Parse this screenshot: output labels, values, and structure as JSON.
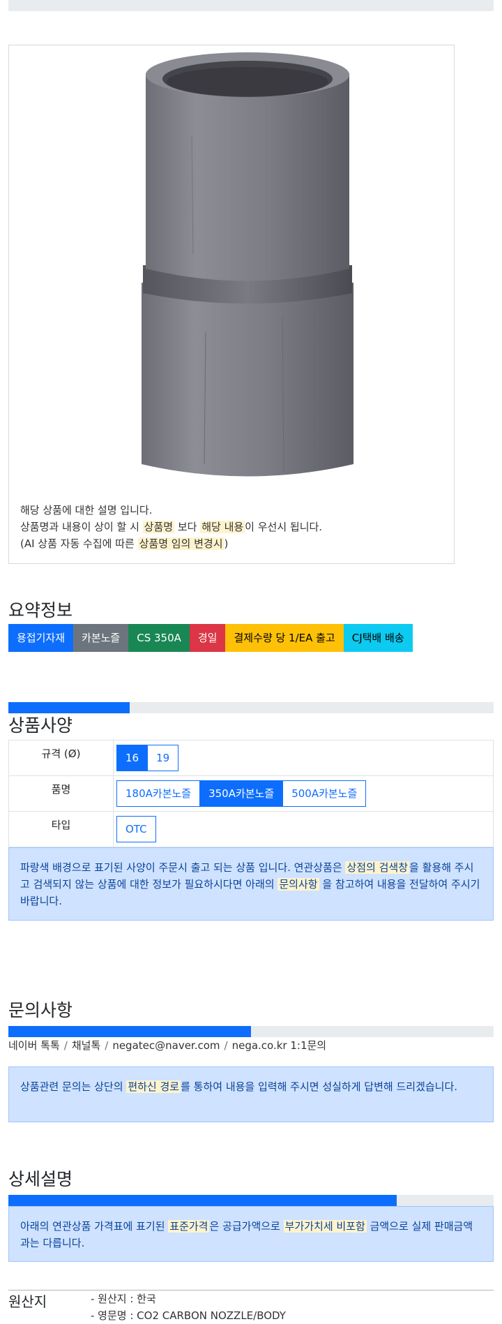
{
  "product": {
    "image_name": "carbon-nozzle-image",
    "desc_line1": "해당 상품에 대한 설명 입니다.",
    "desc_line2_a": "상품명과 내용이 상이 할 시 ",
    "desc_line2_hl1": "상품명",
    "desc_line2_b": " 보다 ",
    "desc_line2_hl2": "해당 내용",
    "desc_line2_c": "이 우선시 됩니다.",
    "desc_line3_a": "(AI 상품 자동 수집에 따른 ",
    "desc_line3_hl": "상품명 임의 변경시",
    "desc_line3_b": ")"
  },
  "summary": {
    "title": "요약정보",
    "badges": [
      {
        "label": "용접기자재",
        "color": "#0d6efd",
        "text_color": "#ffffff"
      },
      {
        "label": "카본노즐",
        "color": "#6c757d",
        "text_color": "#ffffff"
      },
      {
        "label": "CS 350A",
        "color": "#198754",
        "text_color": "#ffffff"
      },
      {
        "label": "경일",
        "color": "#dc3545",
        "text_color": "#ffffff"
      },
      {
        "label": "결제수량 당 1/EA 출고",
        "color": "#ffc107",
        "text_color": "#000000"
      },
      {
        "label": "CJ택배 배송",
        "color": "#0dcaf0",
        "text_color": "#000000"
      }
    ]
  },
  "spec": {
    "title": "상품사양",
    "progress_fraction": 0.25,
    "rows": [
      {
        "label": "규격 (Ø)",
        "options": [
          {
            "label": "16",
            "active": true
          },
          {
            "label": "19",
            "active": false
          }
        ]
      },
      {
        "label": "품명",
        "options": [
          {
            "label": "180A카본노즐",
            "active": false
          },
          {
            "label": "350A카본노즐",
            "active": true
          },
          {
            "label": "500A카본노즐",
            "active": false
          }
        ]
      },
      {
        "label": "타입",
        "options": [
          {
            "label": "OTC",
            "active": false
          }
        ]
      }
    ],
    "notice_a": "파랑색 배경으로 표기된 사양이 주문시 출고 되는 상품 입니다. 연관상품은 ",
    "notice_hl1": "상점의 검색창",
    "notice_b": "을 활용해 주시고 검색되지 않는 상품에 대한 정보가 필요하시다면 아래의 ",
    "notice_hl2": "문의사항",
    "notice_c": " 을 참고하여 내용을 전달하여 주시기 바랍니다."
  },
  "inquiry": {
    "title": "문의사항",
    "progress_fraction": 0.5,
    "links": [
      "네이버 톡톡",
      "채널톡",
      "negatec@naver.com",
      "nega.co.kr 1:1문의"
    ],
    "separator": "/",
    "notice_a": "상품관련 문의는 상단의 ",
    "notice_hl": "편하신 경로",
    "notice_b": "를 통하여 내용을 입력해 주시면 성실하게 답변해 드리겠습니다."
  },
  "detail": {
    "title": "상세설명",
    "progress_fraction": 0.8,
    "notice_a": "아래의 연관상품 가격표에 표기된 ",
    "notice_hl1": "표준가격",
    "notice_b": "은 공급가액으로 ",
    "notice_hl2": "부가가치세 비포함",
    "notice_c": " 금액으로 실제 판매금액과는 다릅니다."
  },
  "origin": {
    "title": "원산지",
    "items": [
      "- 원산지 : 한국",
      "- 영문명 : CO2 CARBON NOZZLE/BODY"
    ]
  }
}
